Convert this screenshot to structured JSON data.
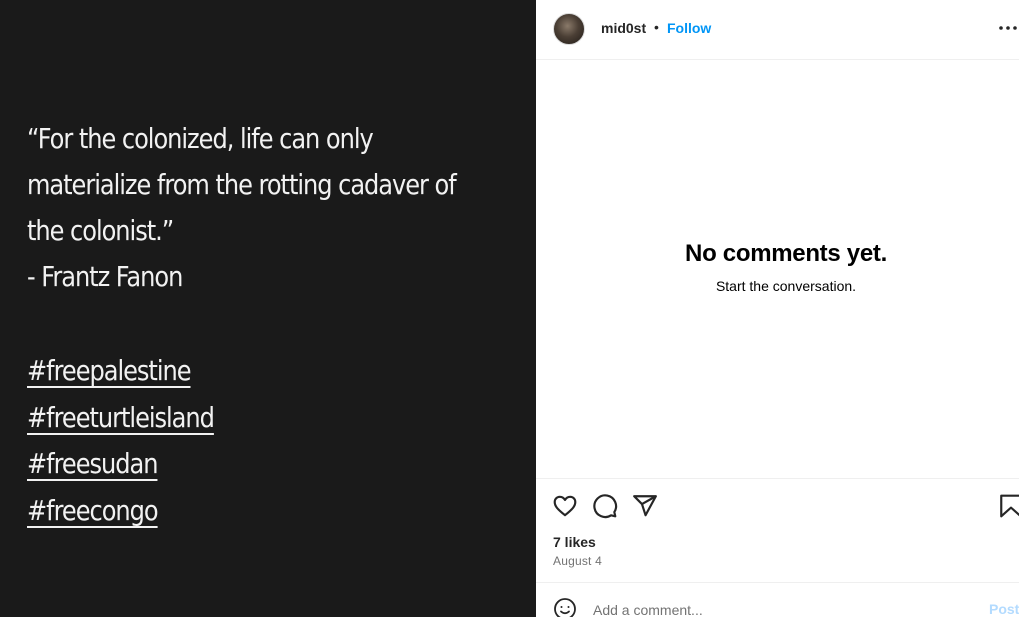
{
  "post": {
    "quote_lines": [
      "“For the colonized, life can only",
      "materialize from the rotting cadaver of",
      "the colonist.”",
      "- Frantz Fanon"
    ],
    "hashtags": [
      "#freepalestine",
      "#freeturtleisland",
      "#freesudan",
      "#freecongo"
    ]
  },
  "header": {
    "username": "mid0st",
    "separator": "•",
    "follow_label": "Follow",
    "more_label": "..."
  },
  "comments": {
    "empty_title": "No comments yet.",
    "empty_subtitle": "Start the conversation."
  },
  "actions": {
    "like_icon": "heart-icon",
    "comment_icon": "comment-icon",
    "share_icon": "send-icon",
    "save_icon": "bookmark-icon",
    "likes_text": "7 likes",
    "date_text": "August 4"
  },
  "comment_bar": {
    "emoji_icon": "emoji-icon",
    "placeholder": "Add a comment...",
    "post_label": "Post"
  },
  "colors": {
    "image_background": "#1a1a1a",
    "link_blue": "#0095f6",
    "post_disabled": "#b3dbff"
  }
}
